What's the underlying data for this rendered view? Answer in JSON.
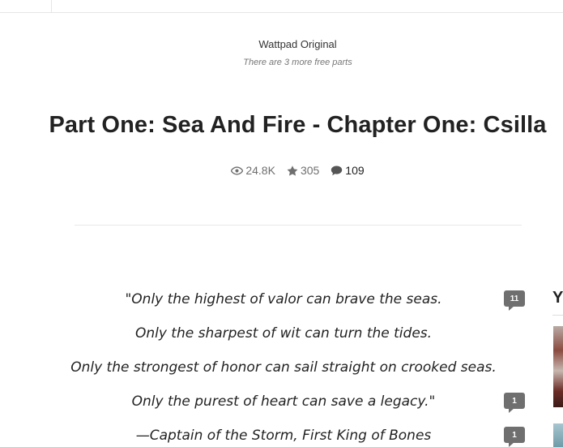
{
  "header": {
    "badge": "Wattpad Original",
    "free_parts": "There are 3 more free parts"
  },
  "story": {
    "title": "Part One: Sea And Fire - Chapter One: Csilla",
    "stats": {
      "reads": "24.8K",
      "votes": "305",
      "comments": "109"
    },
    "lines": [
      {
        "text": "\"Only the highest of valor can brave the seas.",
        "comments": "11"
      },
      {
        "text": "Only the sharpest of wit can turn the tides.",
        "comments": ""
      },
      {
        "text": "Only the strongest of honor can sail straight on crooked seas.",
        "comments": ""
      },
      {
        "text": "Only the purest of heart can save a legacy.\"",
        "comments": "1"
      },
      {
        "text": "—Captain of the Storm, First King of Bones",
        "comments": "1"
      }
    ]
  },
  "sidebar": {
    "heading_fragment": "Y"
  },
  "icons": {
    "reads": "eye-icon",
    "votes": "star-icon",
    "comments": "speech-bubble-icon"
  },
  "colors": {
    "badge": "#6f6f6f",
    "muted": "#6f6f6f"
  }
}
